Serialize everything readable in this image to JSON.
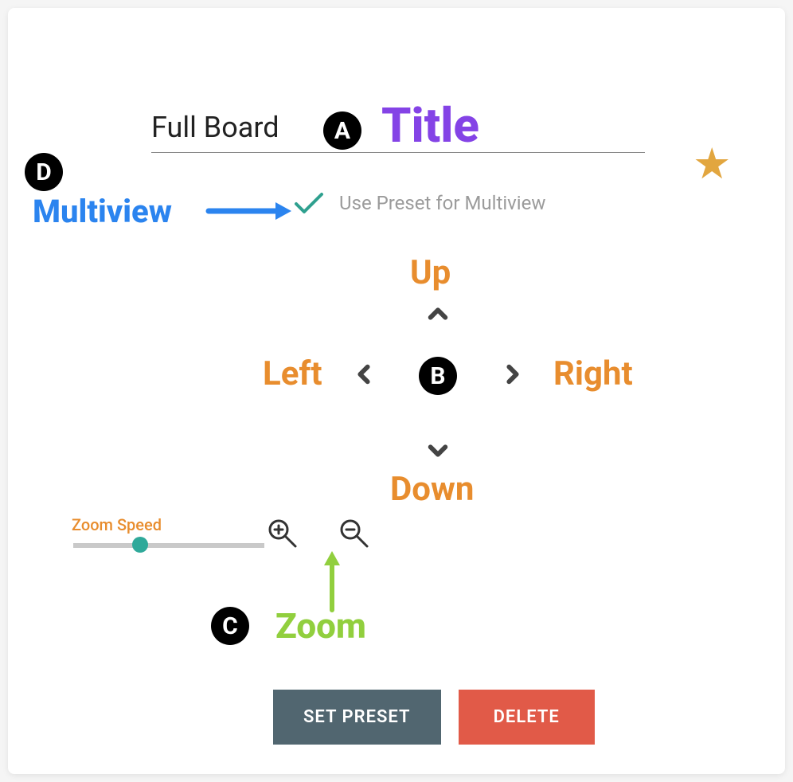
{
  "title": {
    "value": "Full Board"
  },
  "multiview": {
    "label": "Use Preset for Multiview",
    "checked": true
  },
  "directions": {
    "up": "Up",
    "down": "Down",
    "left": "Left",
    "right": "Right"
  },
  "zoom": {
    "speed_label": "Zoom Speed",
    "speed_value": 0.32
  },
  "buttons": {
    "set": "SET PRESET",
    "delete": "DELETE"
  },
  "annotations": {
    "A": "A",
    "B": "B",
    "C": "C",
    "D": "D",
    "title_word": "Title",
    "multiview_word": "Multiview",
    "zoom_word": "Zoom"
  }
}
